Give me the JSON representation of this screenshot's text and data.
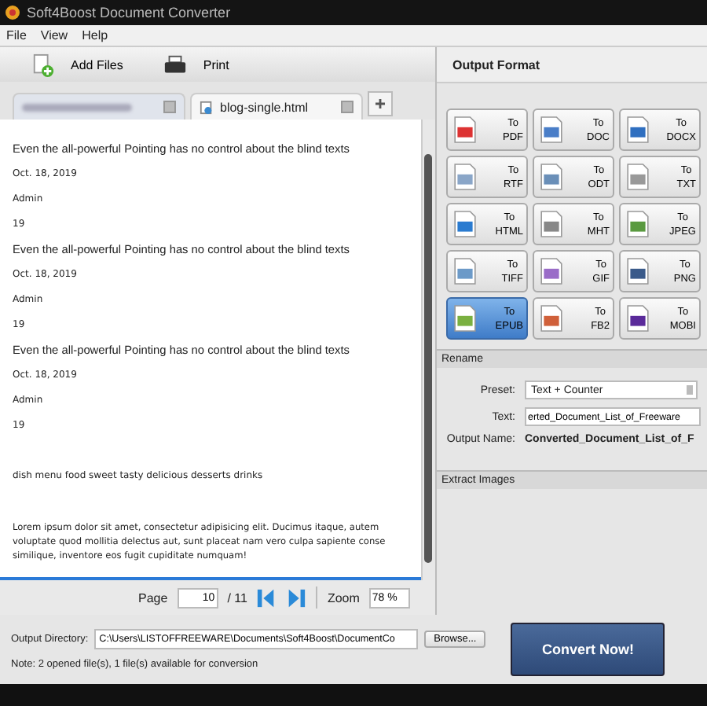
{
  "window": {
    "title": "Soft4Boost Document Converter"
  },
  "menu": [
    "File",
    "View",
    "Help"
  ],
  "toolbar": [
    {
      "kind": "add",
      "label": "Add Files"
    },
    {
      "kind": "print",
      "label": "Print"
    }
  ],
  "tabs": [
    {
      "blurred": true,
      "selected": false
    },
    {
      "blurred": false,
      "label": "blog-single.html",
      "selected": true
    }
  ],
  "document": {
    "lines": [
      {
        "kind": "title",
        "text": "Even the all-powerful Pointing has no control about the blind texts"
      },
      {
        "kind": "meta",
        "text": "Oct. 18, 2019"
      },
      {
        "kind": "meta",
        "text": "Admin"
      },
      {
        "kind": "meta",
        "text": "19"
      },
      {
        "kind": "title",
        "text": "Even the all-powerful Pointing has no control about the blind texts"
      },
      {
        "kind": "meta",
        "text": "Oct. 18, 2019"
      },
      {
        "kind": "meta",
        "text": "Admin"
      },
      {
        "kind": "meta",
        "text": "19"
      },
      {
        "kind": "title",
        "text": "Even the all-powerful Pointing has no control about the blind texts"
      },
      {
        "kind": "meta",
        "text": "Oct. 18, 2019"
      },
      {
        "kind": "meta",
        "text": "Admin"
      },
      {
        "kind": "meta",
        "text": "19"
      },
      {
        "kind": "tags",
        "text": "dish  menu  food  sweet  tasty  delicious  desserts  drinks"
      },
      {
        "kind": "body",
        "text": "Lorem ipsum dolor sit amet, consectetur adipisicing elit. Ducimus itaque, autem"
      },
      {
        "kind": "body",
        "text": "voluptate quod mollitia delectus aut, sunt placeat nam vero culpa sapiente conse"
      },
      {
        "kind": "body",
        "text": "similique, inventore eos fugit cupiditate numquam!"
      }
    ]
  },
  "pager": {
    "label": "Page",
    "page": "10",
    "total": "/ 11",
    "zoom_label": "Zoom",
    "zoom": "78 %"
  },
  "output_format": {
    "title": "Output Format",
    "formats": [
      {
        "prefix": "To",
        "name": "PDF",
        "selected": false
      },
      {
        "prefix": "To",
        "name": "DOC",
        "selected": false
      },
      {
        "prefix": "To",
        "name": "DOCX",
        "selected": false
      },
      {
        "prefix": "To",
        "name": "RTF",
        "selected": false
      },
      {
        "prefix": "To",
        "name": "ODT",
        "selected": false
      },
      {
        "prefix": "To",
        "name": "TXT",
        "selected": false
      },
      {
        "prefix": "To",
        "name": "HTML",
        "selected": false
      },
      {
        "prefix": "To",
        "name": "MHT",
        "selected": false
      },
      {
        "prefix": "To",
        "name": "JPEG",
        "selected": false
      },
      {
        "prefix": "To",
        "name": "TIFF",
        "selected": false
      },
      {
        "prefix": "To",
        "name": "GIF",
        "selected": false
      },
      {
        "prefix": "To",
        "name": "PNG",
        "selected": false
      },
      {
        "prefix": "To",
        "name": "EPUB",
        "selected": true
      },
      {
        "prefix": "To",
        "name": "FB2",
        "selected": false
      },
      {
        "prefix": "To",
        "name": "MOBI",
        "selected": false
      }
    ]
  },
  "rename": {
    "title": "Rename",
    "preset_label": "Preset:",
    "preset": "Text + Counter",
    "text_label": "Text:",
    "text": "erted_Document_List_of_Freeware",
    "output_name_label": "Output Name:",
    "output_name": "Converted_Document_List_of_F"
  },
  "extract_images": {
    "title": "Extract Images"
  },
  "output": {
    "label": "Output Directory:",
    "path": "C:\\Users\\LISTOFFREEWARE\\Documents\\Soft4Boost\\DocumentCo",
    "browse": "Browse...",
    "note": "Note: 2 opened file(s), 1 file(s) available for conversion",
    "convert": "Convert Now!"
  }
}
